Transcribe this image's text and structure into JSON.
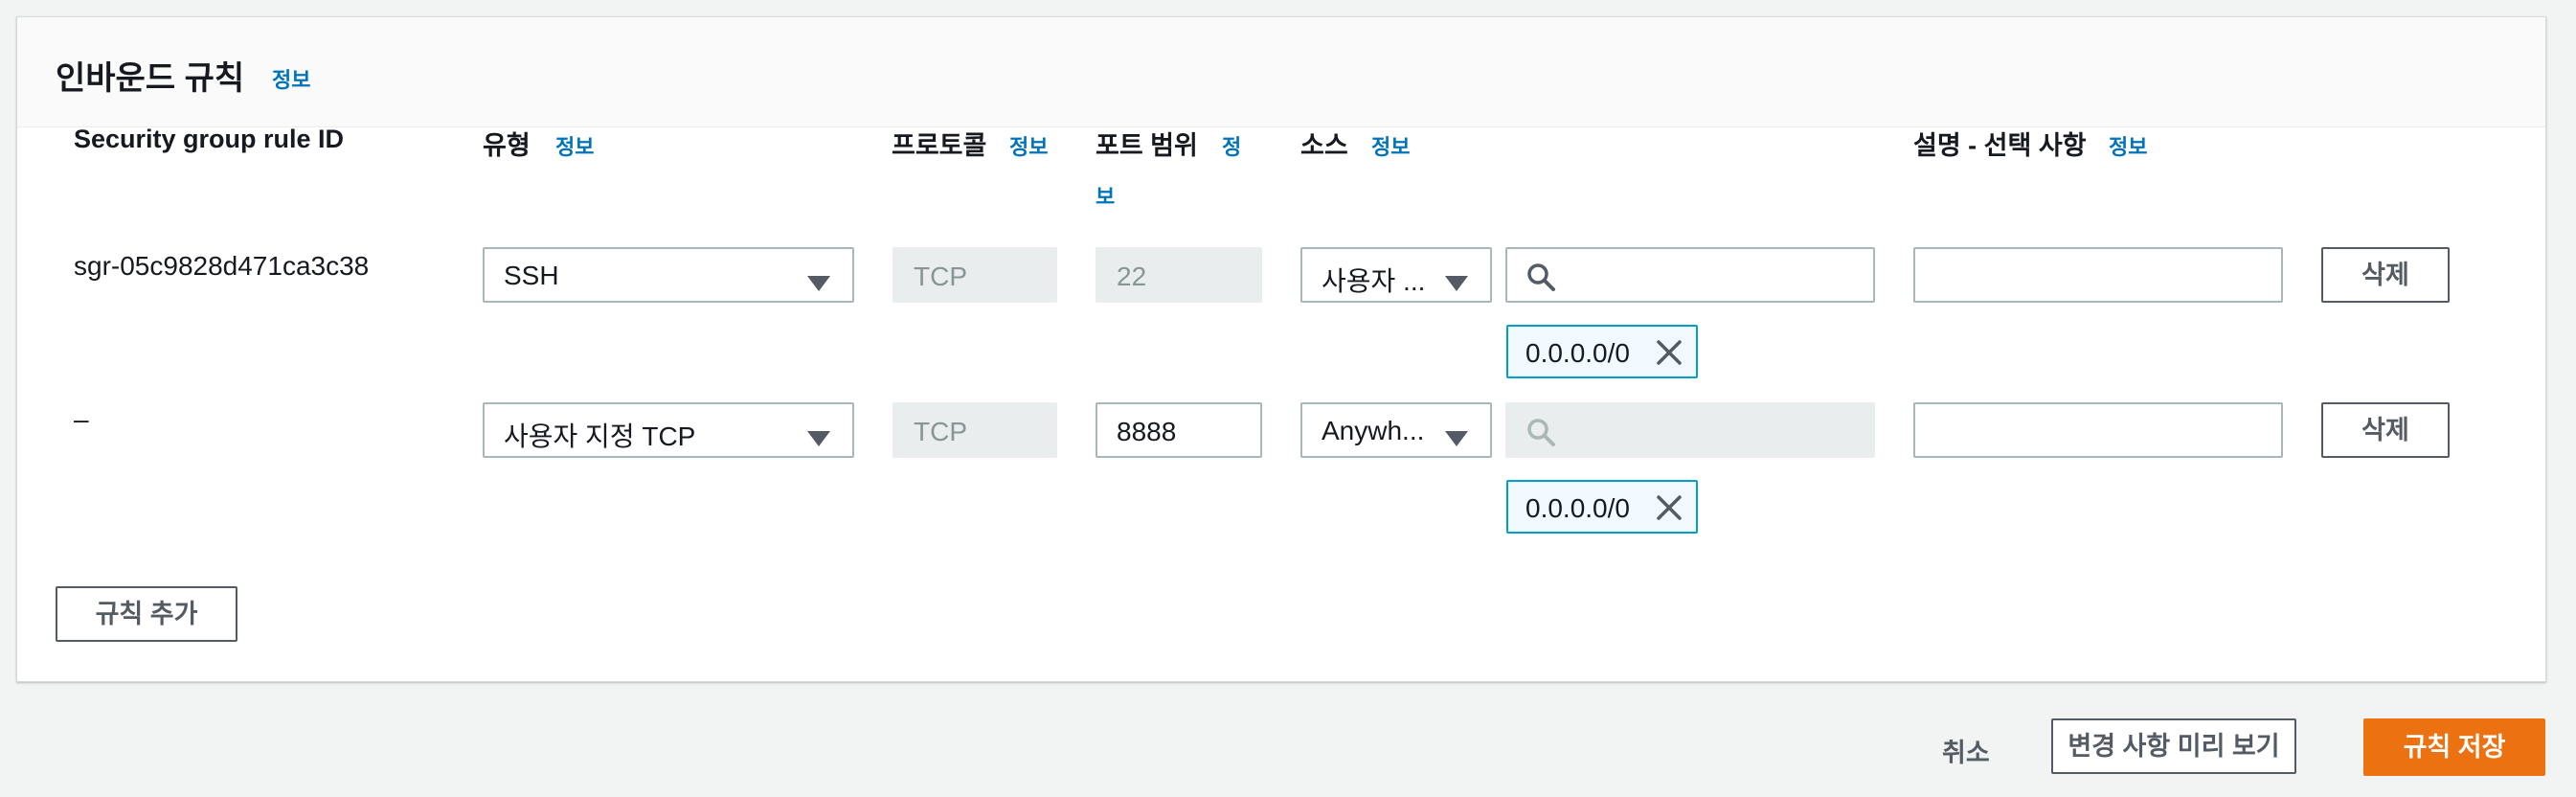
{
  "panel": {
    "title": "인바운드 규칙",
    "info": "정보"
  },
  "columns": {
    "rule_id": "Security group rule ID",
    "type": "유형",
    "type_info": "정보",
    "protocol": "프로토콜",
    "protocol_info": "정보",
    "port_range": "포트 범위",
    "port_info_1": "정",
    "port_info_2": "보",
    "source": "소스",
    "source_info": "정보",
    "description": "설명 - 선택 사항",
    "description_info": "정보"
  },
  "rules": [
    {
      "rule_id": "sgr-05c9828d471ca3c38",
      "type": "SSH",
      "protocol": "TCP",
      "port": "22",
      "source_select": "사용자 ...",
      "source_search": "",
      "cidr": "0.0.0.0/0",
      "description": "",
      "delete": "삭제"
    },
    {
      "rule_id": "–",
      "type": "사용자 지정 TCP",
      "protocol": "TCP",
      "port": "8888",
      "source_select": "Anywh...",
      "source_search": "",
      "cidr": "0.0.0.0/0",
      "description": "",
      "delete": "삭제"
    }
  ],
  "add_rule": "규칙 추가",
  "footer": {
    "cancel": "취소",
    "preview": "변경 사항 미리 보기",
    "save": "규칙 저장"
  },
  "colors": {
    "link": "#0073bb",
    "primary": "#ec7211",
    "token_border": "#00a1c9"
  },
  "icons": [
    "caret-down-icon",
    "search-icon",
    "close-icon"
  ]
}
